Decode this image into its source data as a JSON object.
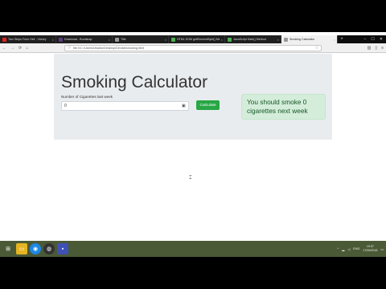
{
  "browser": {
    "tabs": [
      {
        "title": "Two Steps From Hell - Victory",
        "color": "#e62117",
        "active": false
      },
      {
        "title": "Download - Bootstrap",
        "color": "#563d7c",
        "active": false
      },
      {
        "title": "Title",
        "color": "#999999",
        "active": false
      },
      {
        "title": "HTML DOM getElementById() Method",
        "color": "#4caf50",
        "active": false
      },
      {
        "title": "JavaScript Date() Method",
        "color": "#4caf50",
        "active": false
      },
      {
        "title": "Smoking Calculator",
        "color": "#999999",
        "active": true
      }
    ],
    "url": "file:///C:/Users/Ubaldo/Desktop/Devlab/smoking.html"
  },
  "page": {
    "title": "Smoking Calculator",
    "input_label": "Number of Cigarettes last week",
    "input_value": "0",
    "button_label": "Calculate",
    "result_text": "You should smoke 0 cigarettes next week"
  },
  "taskbar": {
    "tray_lang": "ENG",
    "time": "19:37",
    "date": "17/09/2018"
  }
}
